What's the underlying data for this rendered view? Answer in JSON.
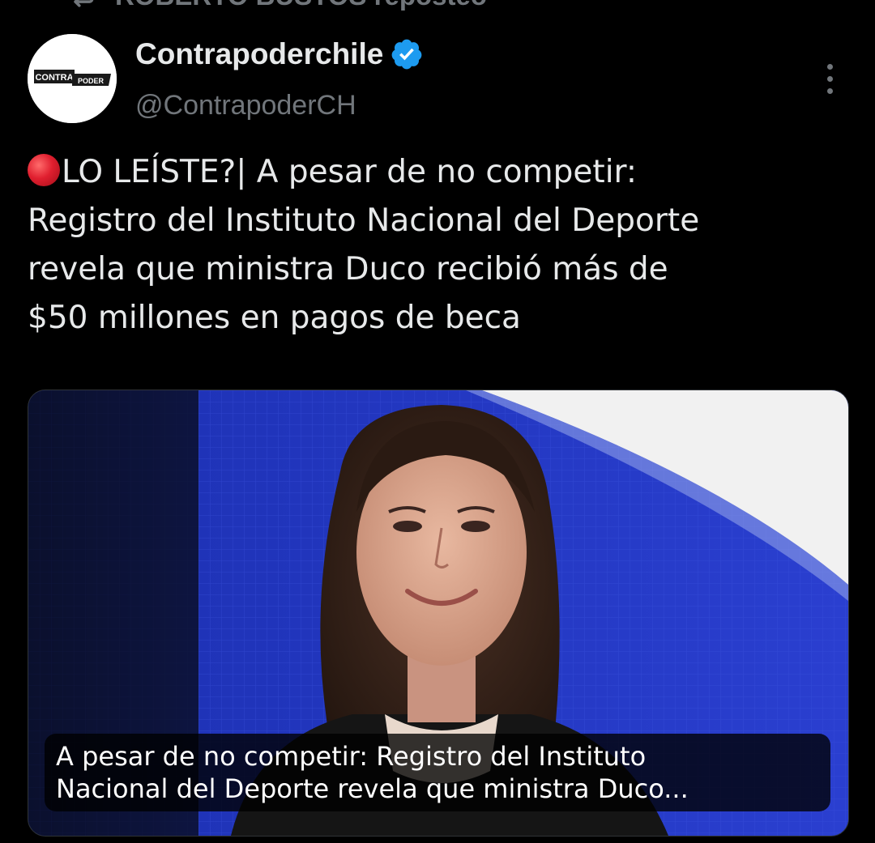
{
  "repost": {
    "text": "ROBERTO BUSTOS reposteó",
    "icon": "repost-icon"
  },
  "author": {
    "display_name": "Contrapoderchile",
    "handle": "@ContrapoderCH",
    "verified": true,
    "avatar_logo": {
      "word1": "CONTRA",
      "word2": "PODER"
    }
  },
  "tweet": {
    "emoji_icon": "red-circle-icon",
    "lines": [
      "LO LEÍSTE?| A pesar de no competir:",
      "Registro del Instituto Nacional del Deporte",
      "revela que ministra Duco recibió más de",
      "$50 millones en pagos de beca"
    ]
  },
  "card": {
    "caption_lines": [
      "A pesar de no competir: Registro del Instituto",
      "Nacional del Deporte revela que ministra Duco..."
    ]
  },
  "colors": {
    "background": "#000000",
    "text": "#e7e9ea",
    "muted": "#71767b",
    "verified": "#1d9bf0",
    "accent_red": "#e01f2f"
  }
}
